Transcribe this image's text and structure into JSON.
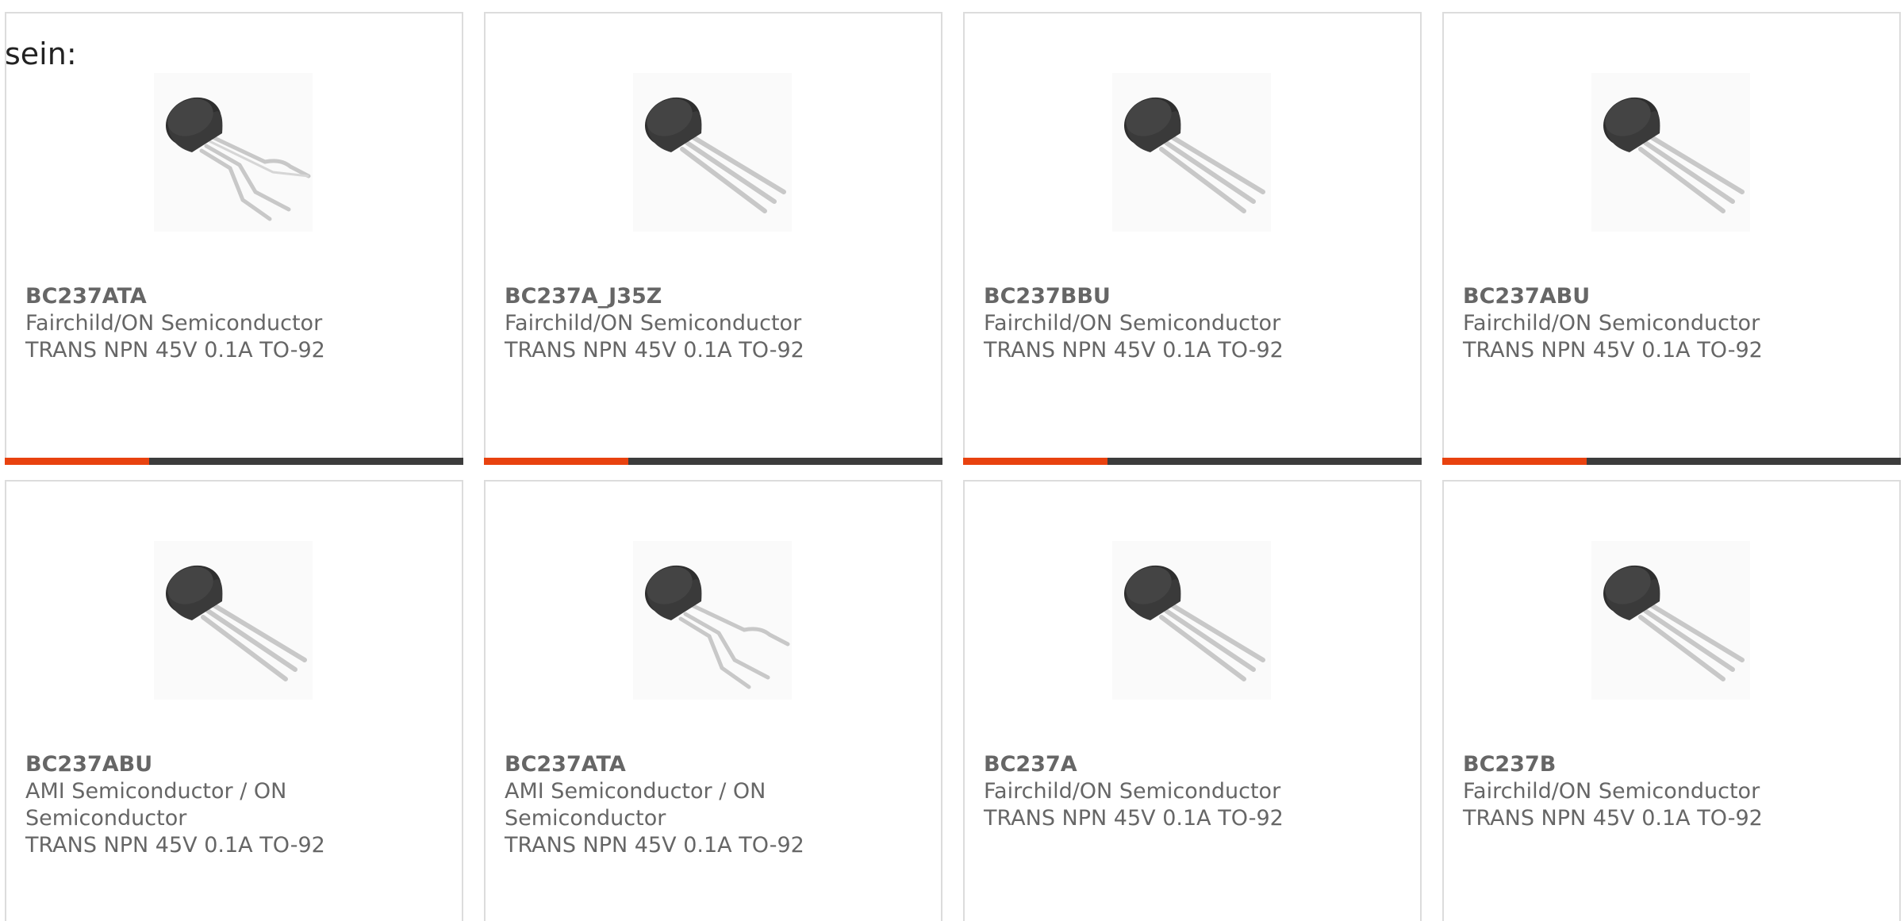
{
  "intro_text": "sein:",
  "colors": {
    "accent": "#e8420f",
    "bar_dark": "#3c3c3c",
    "border": "#dcdcdc",
    "text": "#666666"
  },
  "products": [
    {
      "part": "BC237ATA",
      "manufacturer": "Fairchild/ON Semiconductor",
      "description": "TRANS NPN 45V 0.1A TO-92",
      "image_icon": "to92-transistor-bent-leads-icon"
    },
    {
      "part": "BC237A_J35Z",
      "manufacturer": "Fairchild/ON Semiconductor",
      "description": "TRANS NPN 45V 0.1A TO-92",
      "image_icon": "to92-transistor-icon"
    },
    {
      "part": "BC237BBU",
      "manufacturer": "Fairchild/ON Semiconductor",
      "description": "TRANS NPN 45V 0.1A TO-92",
      "image_icon": "to92-transistor-icon"
    },
    {
      "part": "BC237ABU",
      "manufacturer": "Fairchild/ON Semiconductor",
      "description": "TRANS NPN 45V 0.1A TO-92",
      "image_icon": "to92-transistor-icon"
    },
    {
      "part": "BC237ABU",
      "manufacturer": "AMI Semiconductor / ON Semiconductor",
      "description": "TRANS NPN 45V 0.1A TO-92",
      "image_icon": "to92-transistor-icon"
    },
    {
      "part": "BC237ATA",
      "manufacturer": "AMI Semiconductor / ON Semiconductor",
      "description": "TRANS NPN 45V 0.1A TO-92",
      "image_icon": "to92-transistor-bent-leads-icon"
    },
    {
      "part": "BC237A",
      "manufacturer": "Fairchild/ON Semiconductor",
      "description": "TRANS NPN 45V 0.1A TO-92",
      "image_icon": "to92-transistor-icon"
    },
    {
      "part": "BC237B",
      "manufacturer": "Fairchild/ON Semiconductor",
      "description": "TRANS NPN 45V 0.1A TO-92",
      "image_icon": "to92-transistor-icon"
    }
  ]
}
